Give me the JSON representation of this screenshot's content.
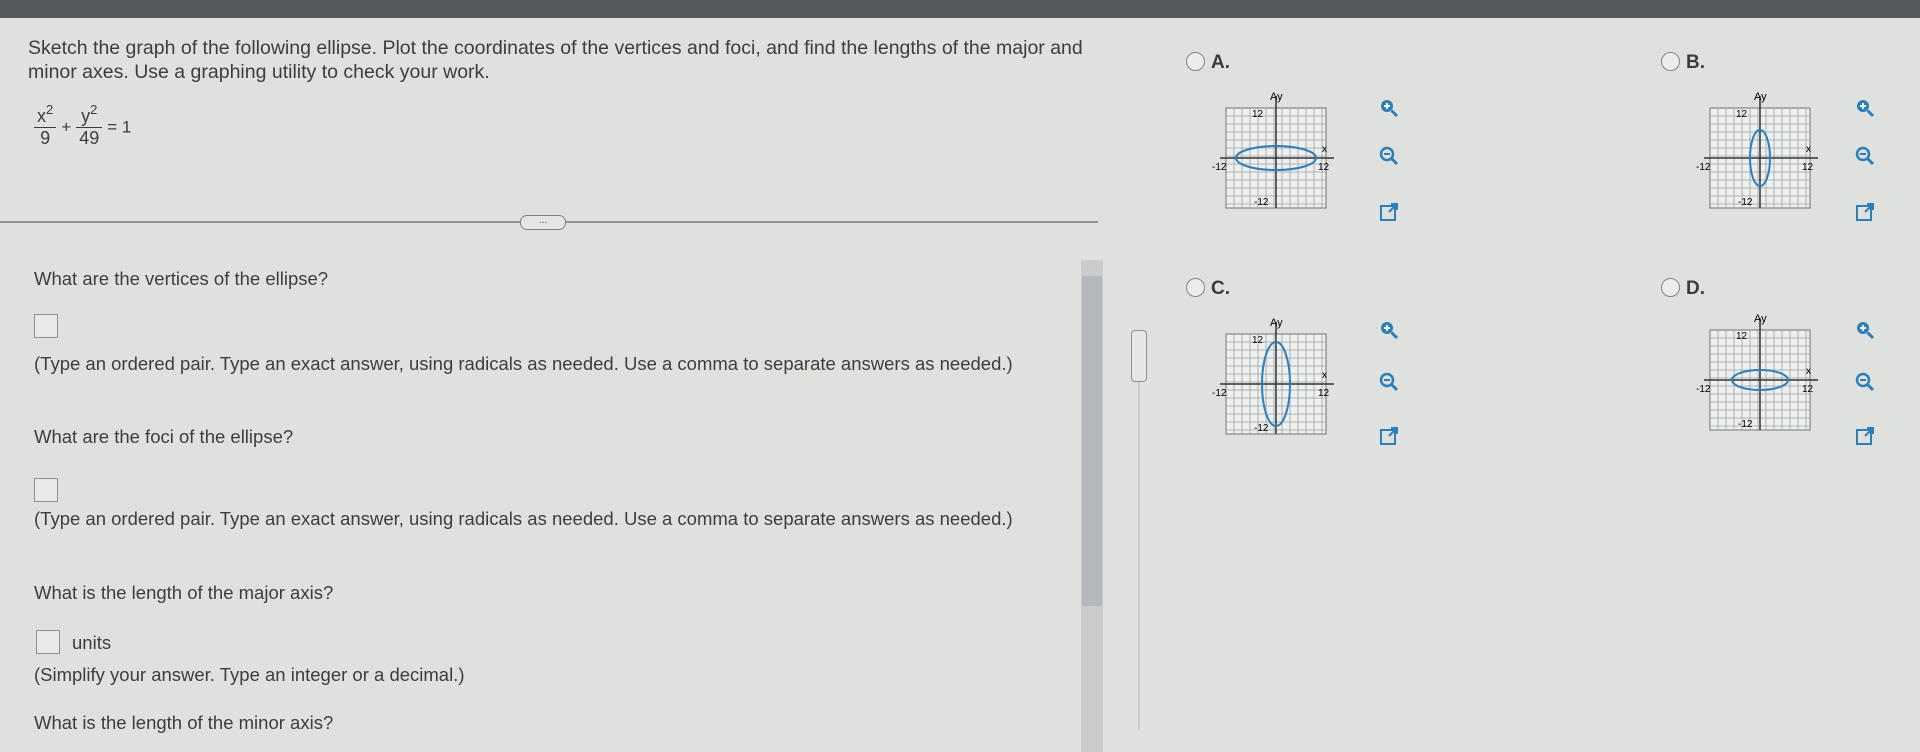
{
  "question": {
    "prompt": "Sketch the graph of the following ellipse. Plot the coordinates of the vertices and foci, and find the lengths of the major and minor axes. Use a graphing utility to check your work.",
    "equation": {
      "num1": "x",
      "num1_exp": "2",
      "den1": "9",
      "plus": "+",
      "num2": "y",
      "num2_exp": "2",
      "den2": "49",
      "rhs": "= 1"
    }
  },
  "expand_label": "...",
  "parts": {
    "vertices": {
      "question": "What are the vertices of the ellipse?",
      "answer": "",
      "note": "(Type an ordered pair. Type an exact answer, using radicals as needed. Use a comma to separate answers as needed.)"
    },
    "foci": {
      "question": "What are the foci of the ellipse?",
      "answer": "",
      "note": "(Type an ordered pair. Type an exact answer, using radicals as needed. Use a comma to separate answers as needed.)"
    },
    "major": {
      "question": "What is the length of the major axis?",
      "answer": "",
      "units": "units",
      "note": "(Simplify your answer. Type an integer or a decimal.)"
    },
    "minor": {
      "question": "What is the length of the minor axis?"
    }
  },
  "options": [
    {
      "label": "A.",
      "ellipse": "horizontal",
      "axis_y": "Ay",
      "axis_x": "x",
      "tick_top": "12",
      "tick_bottom": "-12",
      "tick_left": "-12",
      "tick_right": "12"
    },
    {
      "label": "B.",
      "ellipse": "vertical-narrow",
      "axis_y": "Ay",
      "axis_x": "x",
      "tick_top": "12",
      "tick_bottom": "-12",
      "tick_left": "-12",
      "tick_right": "12"
    },
    {
      "label": "C.",
      "ellipse": "vertical",
      "axis_y": "Ay",
      "axis_x": "x",
      "tick_top": "12",
      "tick_bottom": "-12",
      "tick_left": "-12",
      "tick_right": "12"
    },
    {
      "label": "D.",
      "ellipse": "horizontal-narrow",
      "axis_y": "Ay",
      "axis_x": "x",
      "tick_top": "12",
      "tick_bottom": "-12",
      "tick_left": "-12",
      "tick_right": "12"
    }
  ],
  "icons": [
    "zoom-in-icon",
    "zoom-out-icon",
    "open-external-icon"
  ],
  "colors": {
    "accent": "#2c7fb8",
    "ellipse": "#2c7fb8",
    "text": "#3a3e42"
  }
}
